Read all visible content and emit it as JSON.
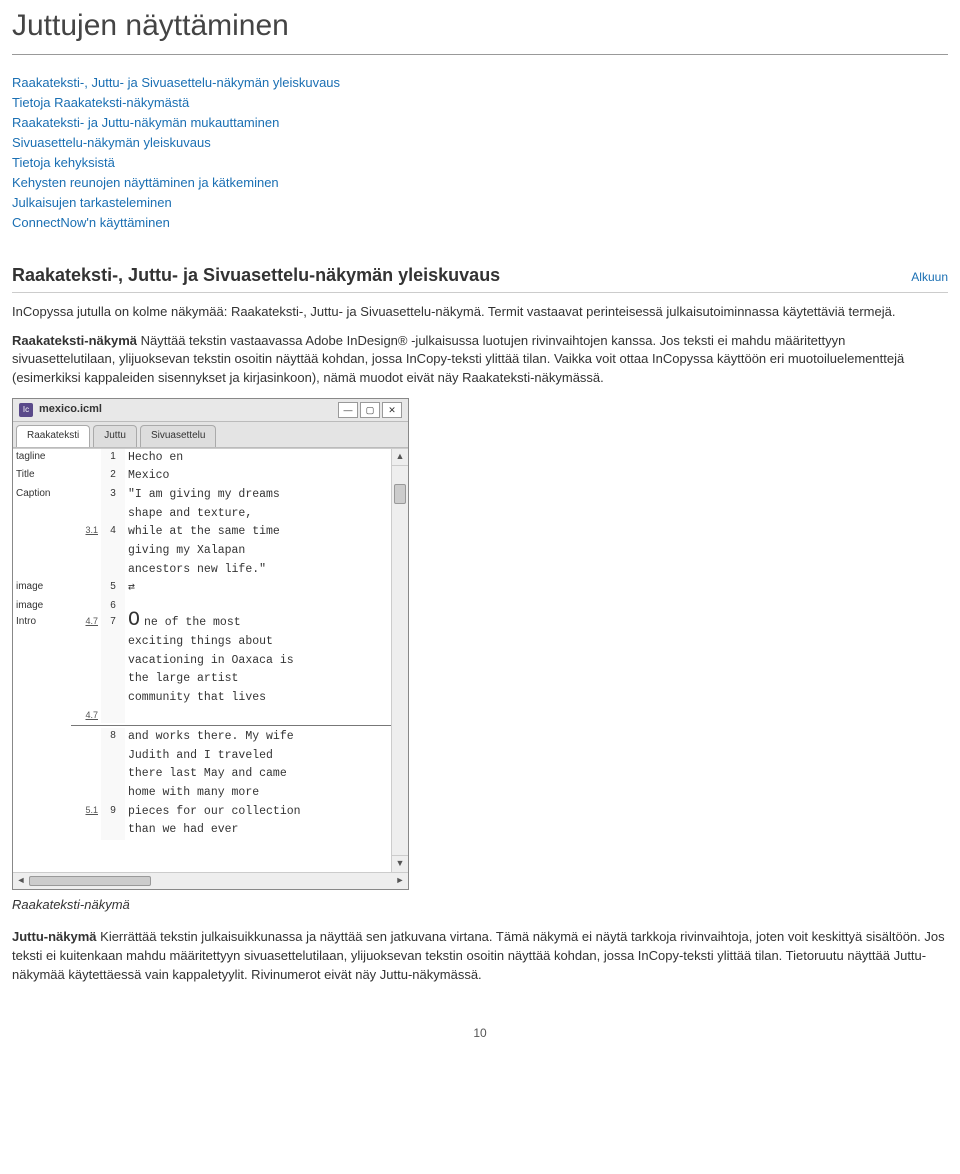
{
  "page": {
    "title": "Juttujen näyttäminen",
    "number": "10"
  },
  "toc": [
    "Raakateksti-, Juttu- ja Sivuasettelu-näkymän yleiskuvaus",
    "Tietoja Raakateksti-näkymästä",
    "Raakateksti- ja Juttu-näkymän mukauttaminen",
    "Sivuasettelu-näkymän yleiskuvaus",
    "Tietoja kehyksistä",
    "Kehysten reunojen näyttäminen ja kätkeminen",
    "Julkaisujen tarkasteleminen",
    "ConnectNow'n käyttäminen"
  ],
  "section": {
    "heading": "Raakateksti-, Juttu- ja Sivuasettelu-näkymän yleiskuvaus",
    "to_top": "Alkuun"
  },
  "para1": "InCopyssa jutulla on kolme näkymää: Raakateksti-, Juttu- ja Sivuasettelu-näkymä. Termit vastaavat perinteisessä julkaisutoiminnassa käytettäviä termejä.",
  "para2_lead": "Raakateksti-näkymä",
  "para2_body": " Näyttää tekstin vastaavassa Adobe InDesign® -julkaisussa luotujen rivinvaihtojen kanssa. Jos teksti ei mahdu määritettyyn sivuasettelutilaan, ylijuoksevan tekstin osoitin näyttää kohdan, jossa InCopy-teksti ylittää tilan. Vaikka voit ottaa InCopyssa käyttöön eri muotoiluelementtejä (esimerkiksi kappaleiden sisennykset ja kirjasinkoon), nämä muodot eivät näy Raakateksti-näkymässä.",
  "caption1": "Raakateksti-näkymä",
  "para3_lead": "Juttu-näkymä",
  "para3_body": " Kierrättää tekstin julkaisuikkunassa ja näyttää sen jatkuvana virtana. Tämä näkymä ei näytä tarkkoja rivinvaihtoja, joten voit keskittyä sisältöön. Jos teksti ei kuitenkaan mahdu määritettyyn sivuasettelutilaan, ylijuoksevan tekstin osoitin näyttää kohdan, jossa InCopy-teksti ylittää tilan. Tietoruutu näyttää Juttu-näkymää käytettäessä vain kappaletyylit. Rivinumerot eivät näy Juttu-näkymässä.",
  "shot": {
    "title": "mexico.icml",
    "tabs": [
      "Raakateksti",
      "Juttu",
      "Sivuasettelu"
    ],
    "active_tab": 0,
    "rows": [
      {
        "tag": "tagline",
        "depth": "",
        "num": "1",
        "text": "Hecho en"
      },
      {
        "tag": "Title",
        "depth": "",
        "num": "2",
        "text": "Mexico"
      },
      {
        "tag": "Caption",
        "depth": "",
        "num": "3",
        "text": "\"I am giving my dreams"
      },
      {
        "tag": "",
        "depth": "",
        "num": "",
        "text": "shape and texture,"
      },
      {
        "tag": "",
        "depth": "3.1",
        "num": "4",
        "text": "while at the same time"
      },
      {
        "tag": "",
        "depth": "",
        "num": "",
        "text": "giving my Xalapan"
      },
      {
        "tag": "",
        "depth": "",
        "num": "",
        "text": "ancestors new life.\""
      },
      {
        "tag": "image",
        "depth": "",
        "num": "5",
        "text": "[anchor]"
      },
      {
        "tag": "image",
        "depth": "",
        "num": "6",
        "text": ""
      },
      {
        "tag": "Intro",
        "depth": "4.7",
        "num": "7",
        "text": "[dropcap:O]  ne of the most"
      },
      {
        "tag": "",
        "depth": "",
        "num": "",
        "text": "exciting things about"
      },
      {
        "tag": "",
        "depth": "",
        "num": "",
        "text": "vacationing in Oaxaca is"
      },
      {
        "tag": "",
        "depth": "",
        "num": "",
        "text": "the large artist"
      },
      {
        "tag": "",
        "depth": "",
        "num": "",
        "text": "community that lives"
      },
      {
        "tag": "",
        "depth": "4.7",
        "num": "",
        "text": "",
        "divider": true
      },
      {
        "tag": "",
        "depth": "",
        "num": "8",
        "text": "and works there. My wife"
      },
      {
        "tag": "",
        "depth": "",
        "num": "",
        "text": "Judith and I traveled"
      },
      {
        "tag": "",
        "depth": "",
        "num": "",
        "text": "there last May and came"
      },
      {
        "tag": "",
        "depth": "",
        "num": "",
        "text": "home with many more"
      },
      {
        "tag": "",
        "depth": "5.1",
        "num": "9",
        "text": "pieces for our collection"
      },
      {
        "tag": "",
        "depth": "",
        "num": "",
        "text": "than we had ever"
      }
    ]
  }
}
